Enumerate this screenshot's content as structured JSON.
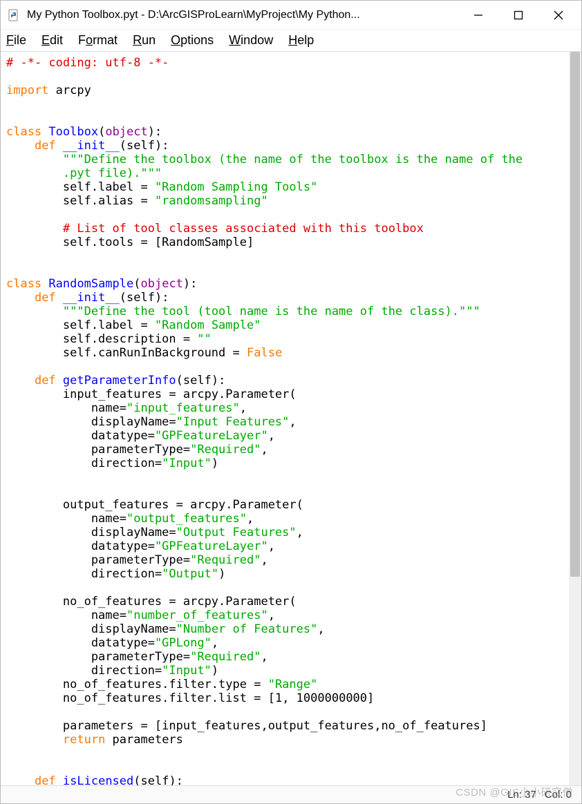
{
  "window": {
    "title": "My Python Toolbox.pyt - D:\\ArcGISProLearn\\MyProject\\My Python..."
  },
  "menu": {
    "file": "File",
    "edit": "Edit",
    "format": "Format",
    "run": "Run",
    "options": "Options",
    "window": "Window",
    "help": "Help"
  },
  "code": {
    "l01_a": "# -*- coding: utf-8 -*-",
    "l03_a": "import",
    "l03_b": " arcpy",
    "l06_a": "class",
    "l06_b": " Toolbox",
    "l06_c": "(",
    "l06_d": "object",
    "l06_e": "):",
    "l07_a": "    ",
    "l07_b": "def",
    "l07_c": " __init__",
    "l07_d": "(self):",
    "l08_a": "        ",
    "l08_b": "\"\"\"Define the toolbox (the name of the toolbox is the name of the",
    "l09_a": "        .pyt file).\"\"\"",
    "l10_a": "        self.label = ",
    "l10_b": "\"Random Sampling Tools\"",
    "l11_a": "        self.alias = ",
    "l11_b": "\"randomsampling\"",
    "l13_a": "        ",
    "l13_b": "# List of tool classes associated with this toolbox",
    "l14_a": "        self.tools = [RandomSample]",
    "l17_a": "class",
    "l17_b": " RandomSample",
    "l17_c": "(",
    "l17_d": "object",
    "l17_e": "):",
    "l18_a": "    ",
    "l18_b": "def",
    "l18_c": " __init__",
    "l18_d": "(self):",
    "l19_a": "        ",
    "l19_b": "\"\"\"Define the tool (tool name is the name of the class).\"\"\"",
    "l20_a": "        self.label = ",
    "l20_b": "\"Random Sample\"",
    "l21_a": "        self.description = ",
    "l21_b": "\"\"",
    "l22_a": "        self.canRunInBackground = ",
    "l22_b": "False",
    "l24_a": "    ",
    "l24_b": "def",
    "l24_c": " getParameterInfo",
    "l24_d": "(self):",
    "l25_a": "        input_features = arcpy.Parameter(",
    "l26_a": "            name=",
    "l26_b": "\"input_features\"",
    "l26_c": ",",
    "l27_a": "            displayName=",
    "l27_b": "\"Input Features\"",
    "l27_c": ",",
    "l28_a": "            datatype=",
    "l28_b": "\"GPFeatureLayer\"",
    "l28_c": ",",
    "l29_a": "            parameterType=",
    "l29_b": "\"Required\"",
    "l29_c": ",",
    "l30_a": "            direction=",
    "l30_b": "\"Input\"",
    "l30_c": ")",
    "l33_a": "        output_features = arcpy.Parameter(",
    "l34_a": "            name=",
    "l34_b": "\"output_features\"",
    "l34_c": ",",
    "l35_a": "            displayName=",
    "l35_b": "\"Output Features\"",
    "l35_c": ",",
    "l36_a": "            datatype=",
    "l36_b": "\"GPFeatureLayer\"",
    "l36_c": ",",
    "l37_a": "            parameterType=",
    "l37_b": "\"Required\"",
    "l37_c": ",",
    "l38_a": "            direction=",
    "l38_b": "\"Output\"",
    "l38_c": ")",
    "l40_a": "        no_of_features = arcpy.Parameter(",
    "l41_a": "            name=",
    "l41_b": "\"number_of_features\"",
    "l41_c": ",",
    "l42_a": "            displayName=",
    "l42_b": "\"Number of Features\"",
    "l42_c": ",",
    "l43_a": "            datatype=",
    "l43_b": "\"GPLong\"",
    "l43_c": ",",
    "l44_a": "            parameterType=",
    "l44_b": "\"Required\"",
    "l44_c": ",",
    "l45_a": "            direction=",
    "l45_b": "\"Input\"",
    "l45_c": ")",
    "l46_a": "        no_of_features.filter.type = ",
    "l46_b": "\"Range\"",
    "l47_a": "        no_of_features.filter.list = [",
    "l47_b": "1",
    "l47_c": ", ",
    "l47_d": "1000000000",
    "l47_e": "]",
    "l49_a": "        parameters = [input_features,output_features,no_of_features]",
    "l50_a": "        ",
    "l50_b": "return",
    "l50_c": " parameters",
    "l53_a": "    ",
    "l53_b": "def",
    "l53_c": " isLicensed",
    "l53_d": "(self):"
  },
  "status": {
    "ln": "Ln: 37",
    "col": "Col: 0"
  },
  "watermark": "CSDN @GIS小小研究僧"
}
